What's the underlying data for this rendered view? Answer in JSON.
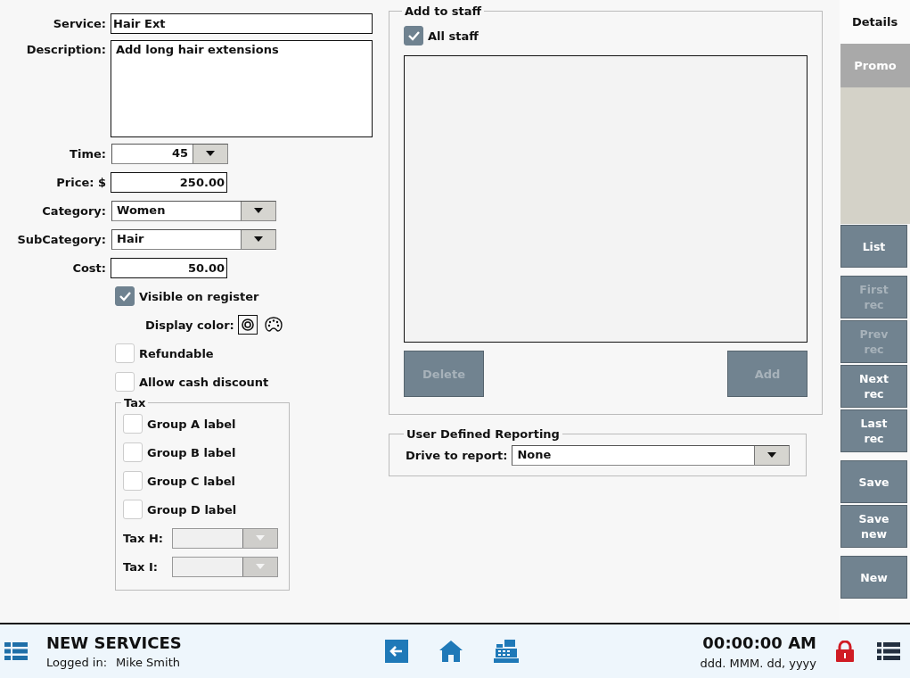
{
  "form": {
    "fields": [
      {
        "label": "Service:",
        "kind": "text",
        "value": "Hair Ext"
      },
      {
        "label": "Description:",
        "kind": "textarea",
        "value": "Add long hair extensions"
      },
      {
        "label": "Time:",
        "kind": "spin",
        "value": "45"
      },
      {
        "label": "Price: $",
        "kind": "number",
        "value": "250.00"
      },
      {
        "label": "Category:",
        "kind": "dropdown",
        "value": "Women"
      },
      {
        "label": "SubCategory:",
        "kind": "dropdown",
        "value": "Hair"
      },
      {
        "label": "Cost:",
        "kind": "number",
        "value": "50.00"
      }
    ],
    "visible_on_register": {
      "label": "Visible on register",
      "checked": true
    },
    "display_color": {
      "label": "Display color:"
    },
    "options": [
      {
        "label": "Refundable",
        "checked": false
      },
      {
        "label": "Allow cash discount",
        "checked": false
      }
    ],
    "tax": {
      "title": "Tax",
      "groups": [
        {
          "label": "Group A label",
          "checked": false
        },
        {
          "label": "Group B label",
          "checked": false
        },
        {
          "label": "Group C label",
          "checked": false
        },
        {
          "label": "Group D label",
          "checked": false
        }
      ],
      "selects": [
        {
          "label": "Tax H:",
          "disabled": true
        },
        {
          "label": "Tax I:",
          "disabled": true
        }
      ]
    }
  },
  "add_to_staff": {
    "title": "Add to staff",
    "all_staff": {
      "label": "All staff",
      "checked": true
    },
    "buttons": [
      {
        "label": "Delete",
        "disabled": true
      },
      {
        "label": "Add",
        "disabled": true
      }
    ]
  },
  "reporting": {
    "title": "User Defined Reporting",
    "label": "Drive to report:",
    "value": "None"
  },
  "side_tabs": [
    {
      "label": "Details",
      "selected": true
    },
    {
      "label": "Promo",
      "selected": false
    }
  ],
  "side_button_groups": [
    [
      {
        "label": "List",
        "disabled": false
      }
    ],
    [
      {
        "label": "First rec",
        "disabled": true
      },
      {
        "label": "Prev rec",
        "disabled": true
      },
      {
        "label": "Next rec",
        "disabled": false
      },
      {
        "label": "Last rec",
        "disabled": false
      }
    ],
    [
      {
        "label": "Save",
        "disabled": false
      },
      {
        "label": "Save new",
        "disabled": false
      }
    ],
    [
      {
        "label": "New",
        "disabled": false
      }
    ]
  ],
  "footer": {
    "title": "NEW SERVICES",
    "logged_in_label": "Logged in:",
    "user": "Mike Smith",
    "time": "00:00:00 AM",
    "date": "ddd. MMM. dd, yyyy"
  }
}
